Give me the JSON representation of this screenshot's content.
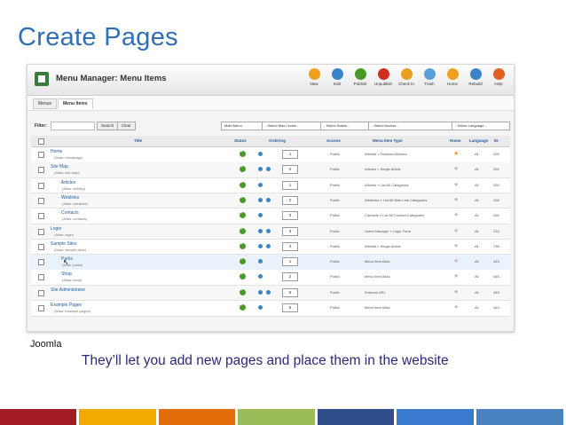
{
  "slide": {
    "title": "Create Pages",
    "source_label": "Joomla",
    "caption": "They’ll let you add new pages and place them in the website",
    "bar_colors": [
      "#a31b22",
      "#f2a900",
      "#e46c0a",
      "#9bbb59",
      "#2e4d8a",
      "#3a7ad0",
      "#4a82c0"
    ]
  },
  "screenshot": {
    "header_title": "Menu Manager: Menu Items",
    "toolbar": [
      {
        "label": "New",
        "color": "#f0a020",
        "icon": "new-icon"
      },
      {
        "label": "Edit",
        "color": "#3c84c8",
        "icon": "edit-icon"
      },
      {
        "label": "Publish",
        "color": "#4a9a2a",
        "icon": "publish-icon"
      },
      {
        "label": "Unpublish",
        "color": "#d03020",
        "icon": "unpublish-icon"
      },
      {
        "label": "Check In",
        "color": "#e8a020",
        "icon": "checkin-icon"
      },
      {
        "label": "Trash",
        "color": "#5aa0d8",
        "icon": "trash-icon"
      },
      {
        "label": "Home",
        "color": "#f0a020",
        "icon": "home-star-icon"
      },
      {
        "label": "Rebuild",
        "color": "#3c84c8",
        "icon": "rebuild-icon"
      },
      {
        "label": "Help",
        "color": "#e06020",
        "icon": "help-icon"
      }
    ],
    "subtabs": [
      "Menus",
      "Menu Items"
    ],
    "filter": {
      "label": "Filter:",
      "search_button": "Search",
      "clear_button": "Clear",
      "selects": [
        "Main Menu",
        "- Select Max Levels -",
        "- Select Status -",
        "- Select Access -",
        "- Select Language -"
      ]
    },
    "columns": [
      "Title",
      "Status",
      "Ordering",
      "Access",
      "Menu Item Type",
      "Home",
      "Language",
      "ID"
    ],
    "rows": [
      {
        "title": "Home",
        "alias": "(Alias: homepage)",
        "access": "Public",
        "type": "Articles » Featured Articles",
        "home": true,
        "lang": "All",
        "id": "435",
        "order": "1",
        "arrows": 1,
        "indent": 0
      },
      {
        "title": "Site Map",
        "alias": "(Alias: site-map)",
        "access": "Public",
        "type": "Articles » Single Article",
        "home": false,
        "lang": "All",
        "id": "294",
        "order": "2",
        "arrows": 2,
        "indent": 0
      },
      {
        "title": "Articles",
        "alias": "(Alias: articles)",
        "access": "Public",
        "type": "Articles » List All Categories",
        "home": false,
        "lang": "All",
        "id": "290",
        "order": "1",
        "arrows": 1,
        "indent": 1
      },
      {
        "title": "Weblinks",
        "alias": "(Alias: weblinks)",
        "access": "Public",
        "type": "Weblinks » List All Web Link Categories",
        "home": false,
        "lang": "All",
        "id": "438",
        "order": "2",
        "arrows": 2,
        "indent": 1
      },
      {
        "title": "Contacts",
        "alias": "(Alias: contacts)",
        "access": "Public",
        "type": "Contacts » List All Contact Categories",
        "home": false,
        "lang": "All",
        "id": "439",
        "order": "3",
        "arrows": 1,
        "indent": 1
      },
      {
        "title": "Login",
        "alias": "(Alias: login)",
        "access": "Public",
        "type": "Users Manager » Login Form",
        "home": false,
        "lang": "All",
        "id": "233",
        "order": "3",
        "arrows": 2,
        "indent": 0
      },
      {
        "title": "Sample Sites",
        "alias": "(Alias: sample-sites)",
        "access": "Public",
        "type": "Articles » Single Article",
        "home": false,
        "lang": "All",
        "id": "238",
        "order": "4",
        "arrows": 2,
        "indent": 0
      },
      {
        "title": "Parks",
        "alias": "(Alias: parks)",
        "access": "Public",
        "type": "Menu Item Alias",
        "home": false,
        "lang": "All",
        "id": "445",
        "order": "1",
        "arrows": 1,
        "indent": 1
      },
      {
        "title": "Shop",
        "alias": "(Alias: shop)",
        "access": "Public",
        "type": "Menu Item Alias",
        "home": false,
        "lang": "All",
        "id": "446",
        "order": "2",
        "arrows": 1,
        "indent": 1
      },
      {
        "title": "Site Administrator",
        "alias": "",
        "access": "Public",
        "type": "External URL",
        "home": false,
        "lang": "All",
        "id": "448",
        "order": "5",
        "arrows": 2,
        "indent": 0
      },
      {
        "title": "Example Pages",
        "alias": "(Alias: example-pages)",
        "access": "Public",
        "type": "Menu Item Alias",
        "home": false,
        "lang": "All",
        "id": "449",
        "order": "6",
        "arrows": 1,
        "indent": 0
      }
    ]
  }
}
